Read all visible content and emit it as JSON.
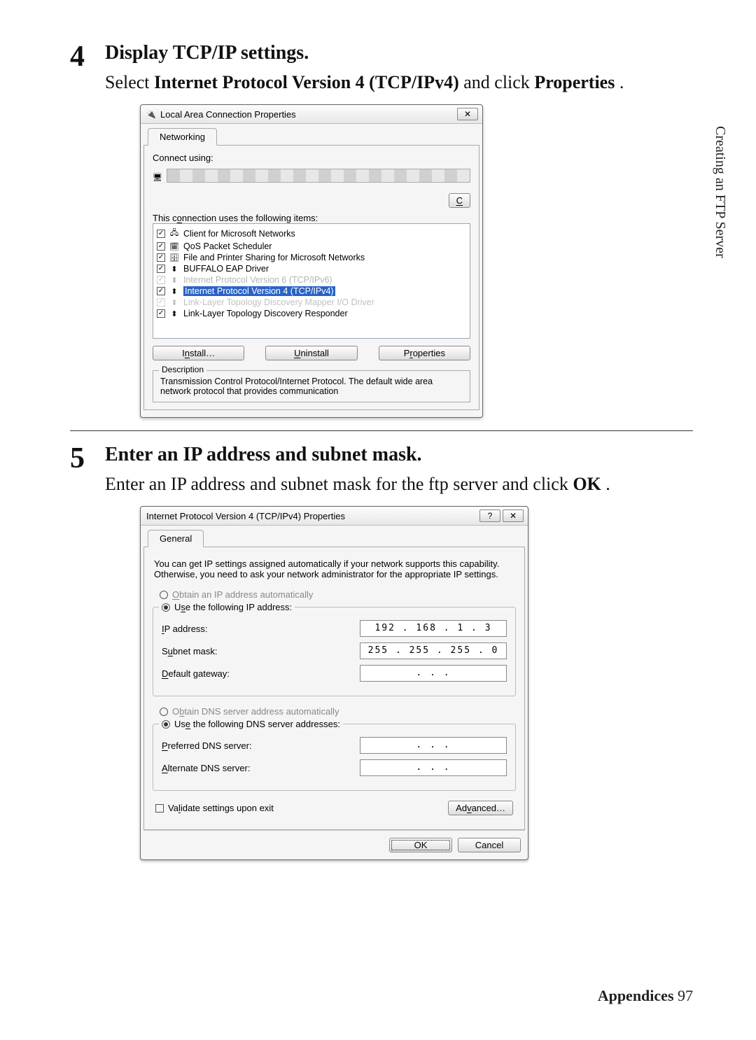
{
  "side_label": "Creating an FTP Server",
  "footer_label": "Appendices",
  "footer_page": "97",
  "step4": {
    "num": "4",
    "title": "Display TCP/IP settings.",
    "desc_pre": "Select ",
    "desc_bold1": "Internet Protocol Version 4 (TCP/IPv4)",
    "desc_mid": " and click ",
    "desc_bold2": "Properties",
    "desc_post": "."
  },
  "step5": {
    "num": "5",
    "title": "Enter an IP address and subnet mask.",
    "desc_pre": "Enter an IP address and subnet mask for the ftp server and click ",
    "desc_bold1": "OK",
    "desc_post": "."
  },
  "dlg1": {
    "title": "Local Area Connection Properties",
    "close": "✕",
    "tab": "Networking",
    "connect_using_label": "Connect using:",
    "configure_btn": "Configure…",
    "items_label": "This connection uses the following items:",
    "items": [
      "Client for Microsoft Networks",
      "QoS Packet Scheduler",
      "File and Printer Sharing for Microsoft Networks",
      "BUFFALO EAP Driver",
      "Internet Protocol Version 6 (TCP/IPv6)",
      "Internet Protocol Version 4 (TCP/IPv4)",
      "Link-Layer Topology Discovery Mapper I/O Driver",
      "Link-Layer Topology Discovery Responder"
    ],
    "install_btn": "Install…",
    "uninstall_btn": "Uninstall",
    "properties_btn": "Properties",
    "desc_legend": "Description",
    "desc_text": "Transmission Control Protocol/Internet Protocol. The default wide area network protocol that provides communication"
  },
  "dlg2": {
    "title": "Internet Protocol Version 4 (TCP/IPv4) Properties",
    "help": "?",
    "close": "✕",
    "tab": "General",
    "intro": "You can get IP settings assigned automatically if your network supports this capability. Otherwise, you need to ask your network administrator for the appropriate IP settings.",
    "radio_auto_ip": "Obtain an IP address automatically",
    "radio_use_ip": "Use the following IP address:",
    "ip_label": "IP address:",
    "ip_value": "192 . 168 .  1  .  3",
    "subnet_label": "Subnet mask:",
    "subnet_value": "255 . 255 . 255 .  0",
    "gateway_label": "Default gateway:",
    "gateway_value": ".     .     .",
    "radio_auto_dns": "Obtain DNS server address automatically",
    "radio_use_dns": "Use the following DNS server addresses:",
    "pref_dns_label": "Preferred DNS server:",
    "pref_dns_value": ".     .     .",
    "alt_dns_label": "Alternate DNS server:",
    "alt_dns_value": ".     .     .",
    "validate_label": "Validate settings upon exit",
    "advanced_btn": "Advanced…",
    "ok_btn": "OK",
    "cancel_btn": "Cancel"
  }
}
